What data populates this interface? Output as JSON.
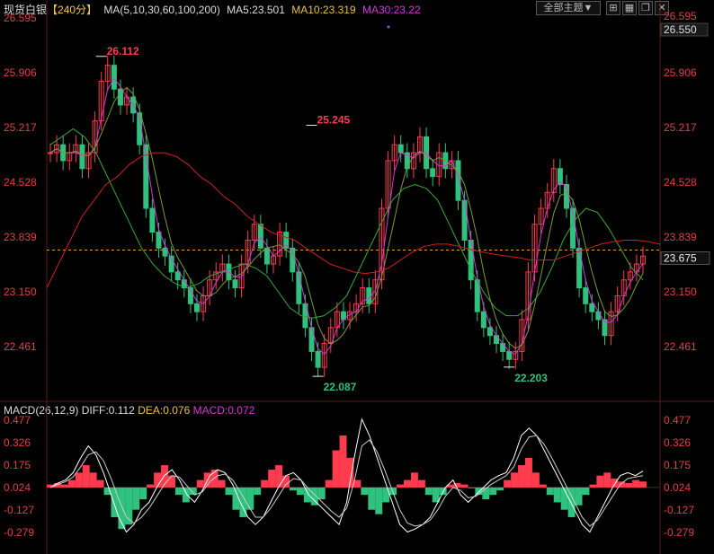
{
  "header": {
    "symbol": "现货白银",
    "period": "【240分】",
    "ma_params": "MA(5,10,30,60,100,200)",
    "ma5": "MA5:23.501",
    "ma10": "MA10:23.319",
    "ma30": "MA30:23.22",
    "theme_button": "全部主题▼",
    "icons": [
      "plus-square-icon",
      "grid-icon",
      "restore-icon",
      "close-icon"
    ]
  },
  "colors": {
    "up": "#ff3b4e",
    "down": "#2ec27e",
    "ma5": "#ffffff",
    "ma10": "#e8c24a",
    "ma30": "#d43ad4",
    "ma_green": "#3aa83a",
    "ma_red": "#cc2222",
    "axis_text": "#e04040",
    "current_price_line": "#e0a040"
  },
  "chart_data": [
    {
      "type": "line",
      "title": "",
      "ylim": [
        22.087,
        26.595
      ],
      "y_ticks": [
        "26.595",
        "25.906",
        "25.217",
        "24.528",
        "23.839",
        "23.150",
        "22.461"
      ],
      "right_labels": {
        "top_box": "26.550",
        "current_price": "23.675"
      },
      "annotations": [
        {
          "label": "26.112",
          "kind": "high"
        },
        {
          "label": "25.245",
          "kind": "high"
        },
        {
          "label": "22.087",
          "kind": "low"
        },
        {
          "label": "22.203",
          "kind": "low"
        }
      ],
      "series": [
        {
          "key": "close",
          "values": [
            24.9,
            25.0,
            24.8,
            24.9,
            25.0,
            24.7,
            24.9,
            25.3,
            25.8,
            26.0,
            25.7,
            25.5,
            25.6,
            25.4,
            25.0,
            24.2,
            23.9,
            23.7,
            23.6,
            23.4,
            23.3,
            23.2,
            23.0,
            22.9,
            23.1,
            23.3,
            23.4,
            23.5,
            23.3,
            23.2,
            23.5,
            23.8,
            24.0,
            23.7,
            23.5,
            23.6,
            23.9,
            23.7,
            23.4,
            23.0,
            22.7,
            22.4,
            22.2,
            22.5,
            22.7,
            22.9,
            22.8,
            22.9,
            23.0,
            23.2,
            23.0,
            23.3,
            24.2,
            24.8,
            25.0,
            24.9,
            24.7,
            24.9,
            25.1,
            24.7,
            24.6,
            24.9,
            24.7,
            24.8,
            24.3,
            23.8,
            23.3,
            22.9,
            22.7,
            22.6,
            22.5,
            22.4,
            22.3,
            22.4,
            22.8,
            23.4,
            24.0,
            24.2,
            24.4,
            24.7,
            24.5,
            24.2,
            23.7,
            23.2,
            23.0,
            22.9,
            22.8,
            22.6,
            22.9,
            23.1,
            23.3,
            23.4,
            23.5,
            23.6
          ]
        },
        {
          "key": "ma_red_long",
          "values": [
            23.2,
            23.5,
            23.8,
            24.1,
            24.3,
            24.5,
            24.6,
            24.75,
            24.85,
            24.9,
            24.9,
            24.85,
            24.75,
            24.6,
            24.5,
            24.35,
            24.25,
            24.1,
            24.0,
            23.9,
            23.85,
            23.8,
            23.7,
            23.6,
            23.5,
            23.45,
            23.4,
            23.38,
            23.4,
            23.45,
            23.55,
            23.65,
            23.72,
            23.75,
            23.75,
            23.72,
            23.68,
            23.65,
            23.62,
            23.6,
            23.58,
            23.55,
            23.55,
            23.55,
            23.6,
            23.65,
            23.7,
            23.75,
            23.78,
            23.8,
            23.8,
            23.78,
            23.75
          ]
        },
        {
          "key": "ma_green",
          "values": [
            25.0,
            25.1,
            25.2,
            25.1,
            24.9,
            24.6,
            24.3,
            24.0,
            23.7,
            23.5,
            23.35,
            23.25,
            23.2,
            23.25,
            23.35,
            23.4,
            23.45,
            23.5,
            23.45,
            23.35,
            23.15,
            22.95,
            22.85,
            22.82,
            22.85,
            22.95,
            23.1,
            23.4,
            23.7,
            24.0,
            24.3,
            24.45,
            24.5,
            24.45,
            24.3,
            24.0,
            23.7,
            23.4,
            23.15,
            22.95,
            22.85,
            22.85,
            22.95,
            23.15,
            23.45,
            23.8,
            24.05,
            24.2,
            24.15,
            23.95,
            23.7,
            23.45,
            23.3
          ]
        },
        {
          "key": "macd_hist",
          "values": [
            0.02,
            0.03,
            0.02,
            0.05,
            0.1,
            0.15,
            0.1,
            0.05,
            -0.05,
            -0.2,
            -0.28,
            -0.25,
            -0.15,
            -0.08,
            0.02,
            0.1,
            0.15,
            0.08,
            -0.05,
            -0.1,
            -0.05,
            0.05,
            0.1,
            0.12,
            0.05,
            -0.05,
            -0.15,
            -0.2,
            -0.15,
            -0.05,
            0.05,
            0.12,
            0.15,
            0.08,
            -0.02,
            -0.05,
            -0.1,
            -0.12,
            -0.08,
            0.05,
            0.25,
            0.35,
            0.2,
            0.05,
            -0.05,
            -0.15,
            -0.18,
            -0.1,
            -0.05,
            0.02,
            0.05,
            0.1,
            0.05,
            -0.05,
            -0.1,
            -0.05,
            0.02,
            0.03,
            0.02,
            0.0,
            -0.05,
            -0.08,
            -0.05,
            -0.02,
            0.05,
            0.1,
            0.15,
            0.2,
            0.1,
            0.02,
            -0.05,
            -0.1,
            -0.15,
            -0.2,
            -0.12,
            -0.05,
            0.02,
            0.08,
            0.1,
            0.06,
            0.04,
            0.03,
            0.05,
            0.04
          ]
        },
        {
          "key": "diff",
          "values": [
            0.0,
            0.03,
            0.05,
            0.1,
            0.2,
            0.28,
            0.22,
            0.1,
            -0.05,
            -0.2,
            -0.3,
            -0.25,
            -0.15,
            -0.1,
            0.0,
            0.08,
            0.12,
            0.05,
            -0.05,
            -0.1,
            -0.02,
            0.08,
            0.12,
            0.1,
            0.02,
            -0.1,
            -0.2,
            -0.25,
            -0.2,
            -0.1,
            0.0,
            0.08,
            0.1,
            0.05,
            -0.05,
            -0.1,
            -0.15,
            -0.2,
            -0.25,
            -0.1,
            0.2,
            0.46,
            0.35,
            0.2,
            0.05,
            -0.1,
            -0.25,
            -0.3,
            -0.28,
            -0.25,
            -0.2,
            -0.1,
            0.0,
            0.05,
            -0.05,
            -0.1,
            -0.05,
            0.0,
            0.05,
            0.08,
            0.1,
            0.2,
            0.35,
            0.4,
            0.35,
            0.25,
            0.15,
            0.05,
            -0.05,
            -0.15,
            -0.25,
            -0.3,
            -0.2,
            -0.1,
            0.0,
            0.08,
            0.1,
            0.08,
            0.11
          ]
        },
        {
          "key": "dea",
          "values": [
            0.0,
            0.02,
            0.04,
            0.07,
            0.14,
            0.22,
            0.24,
            0.18,
            0.06,
            -0.08,
            -0.2,
            -0.24,
            -0.2,
            -0.14,
            -0.06,
            0.02,
            0.08,
            0.07,
            0.01,
            -0.05,
            -0.03,
            0.04,
            0.08,
            0.09,
            0.05,
            -0.03,
            -0.12,
            -0.2,
            -0.2,
            -0.14,
            -0.06,
            0.02,
            0.06,
            0.05,
            -0.01,
            -0.06,
            -0.11,
            -0.16,
            -0.2,
            -0.14,
            0.04,
            0.28,
            0.32,
            0.24,
            0.12,
            -0.02,
            -0.15,
            -0.24,
            -0.26,
            -0.25,
            -0.22,
            -0.15,
            -0.06,
            0.0,
            -0.02,
            -0.07,
            -0.06,
            -0.02,
            0.02,
            0.05,
            0.08,
            0.14,
            0.26,
            0.34,
            0.35,
            0.29,
            0.2,
            0.1,
            0.0,
            -0.1,
            -0.2,
            -0.26,
            -0.22,
            -0.14,
            -0.06,
            0.02,
            0.06,
            0.07,
            0.08
          ]
        }
      ]
    },
    {
      "type": "bar",
      "title": "",
      "ylim": [
        -0.3,
        0.49
      ],
      "y_ticks": [
        "0.477",
        "0.326",
        "0.175",
        "0.024",
        "-0.127",
        "-0.279"
      ]
    }
  ],
  "macd_header": {
    "name": "MACD(26,12,9)",
    "diff": "DIFF:0.112",
    "dea": "DEA:0.076",
    "macd": "MACD:0.072"
  }
}
